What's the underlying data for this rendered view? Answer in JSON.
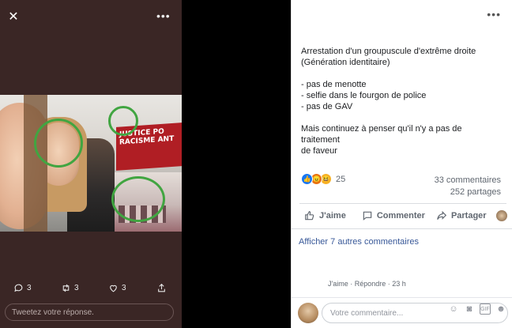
{
  "tweet": {
    "close_icon": "close-icon",
    "more_icon": "more-icon",
    "photo_banner_text": "JUSTICE PO\nRACISME ANT",
    "actions": {
      "reply_count": "3",
      "retweet_count": "3",
      "like_count": "3"
    },
    "reply_placeholder": "Tweetez votre réponse."
  },
  "post": {
    "text_lines": [
      "Arrestation d'un groupuscule d'extrême droite",
      "(Génération identitaire)",
      "",
      "- pas de menotte",
      "- selfie dans le fourgon de police",
      "- pas de GAV",
      "",
      "Mais continuez à penser qu'il n'y a pas de traitement",
      "de faveur"
    ],
    "reaction_count": "25",
    "comments_count": "33 commentaires",
    "shares_count": "252 partages",
    "like_label": "J'aime",
    "comment_label": "Commenter",
    "share_label": "Partager",
    "more_comments": "Afficher 7 autres commentaires",
    "comment_meta": {
      "like": "J'aime",
      "sep": " · ",
      "reply": "Répondre",
      "time": "23 h"
    },
    "comment_placeholder": "Votre commentaire..."
  },
  "colors": {
    "left_bg": "#3a2625",
    "circle": "#41a541",
    "fb_link": "#385898"
  }
}
